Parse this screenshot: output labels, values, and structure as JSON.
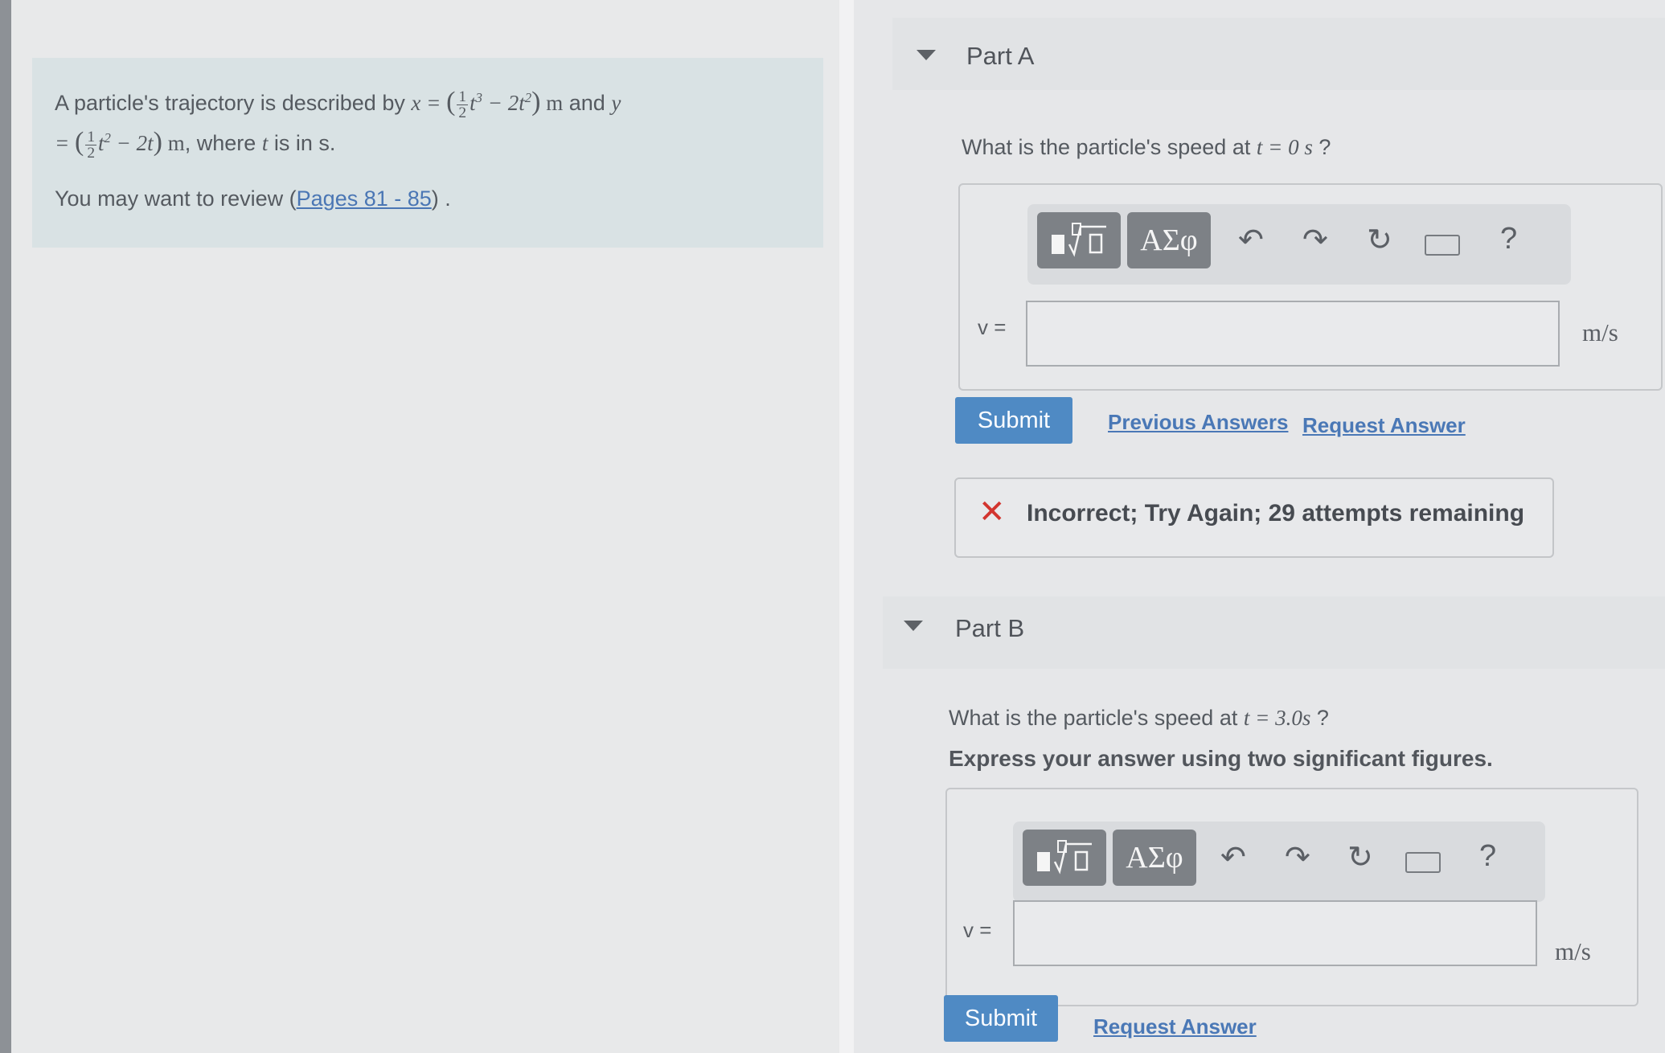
{
  "problem": {
    "intro": "A particle's trajectory is described by",
    "and_text": "and",
    "where_text": ", where",
    "is_in_text": "is in s.",
    "review_text": "You may want to review",
    "review_link": "Pages 81 - 85"
  },
  "part_a": {
    "title": "Part A",
    "question_prefix": "What is the particle's speed at",
    "question_value": "t = 0 s",
    "question_suffix": "?",
    "variable_label": "v =",
    "unit": "m/s",
    "submit_label": "Submit",
    "previous_answers_label": "Previous Answers",
    "request_answer_label": "Request Answer",
    "feedback_text": "Incorrect; Try Again; 29 attempts remaining"
  },
  "part_b": {
    "title": "Part B",
    "question_prefix": "What is the particle's speed at",
    "question_value": "t = 3.0s",
    "question_suffix": "?",
    "instruction": "Express your answer using two significant figures.",
    "variable_label": "v =",
    "unit": "m/s",
    "submit_label": "Submit",
    "request_answer_label": "Request Answer"
  },
  "toolbar": {
    "greek_label": "ΑΣφ",
    "help_label": "?"
  },
  "colors": {
    "submit": "#4f8ac4",
    "link": "#4a76b4",
    "error": "#d2352f",
    "problem_bg": "#d9e2e4"
  }
}
